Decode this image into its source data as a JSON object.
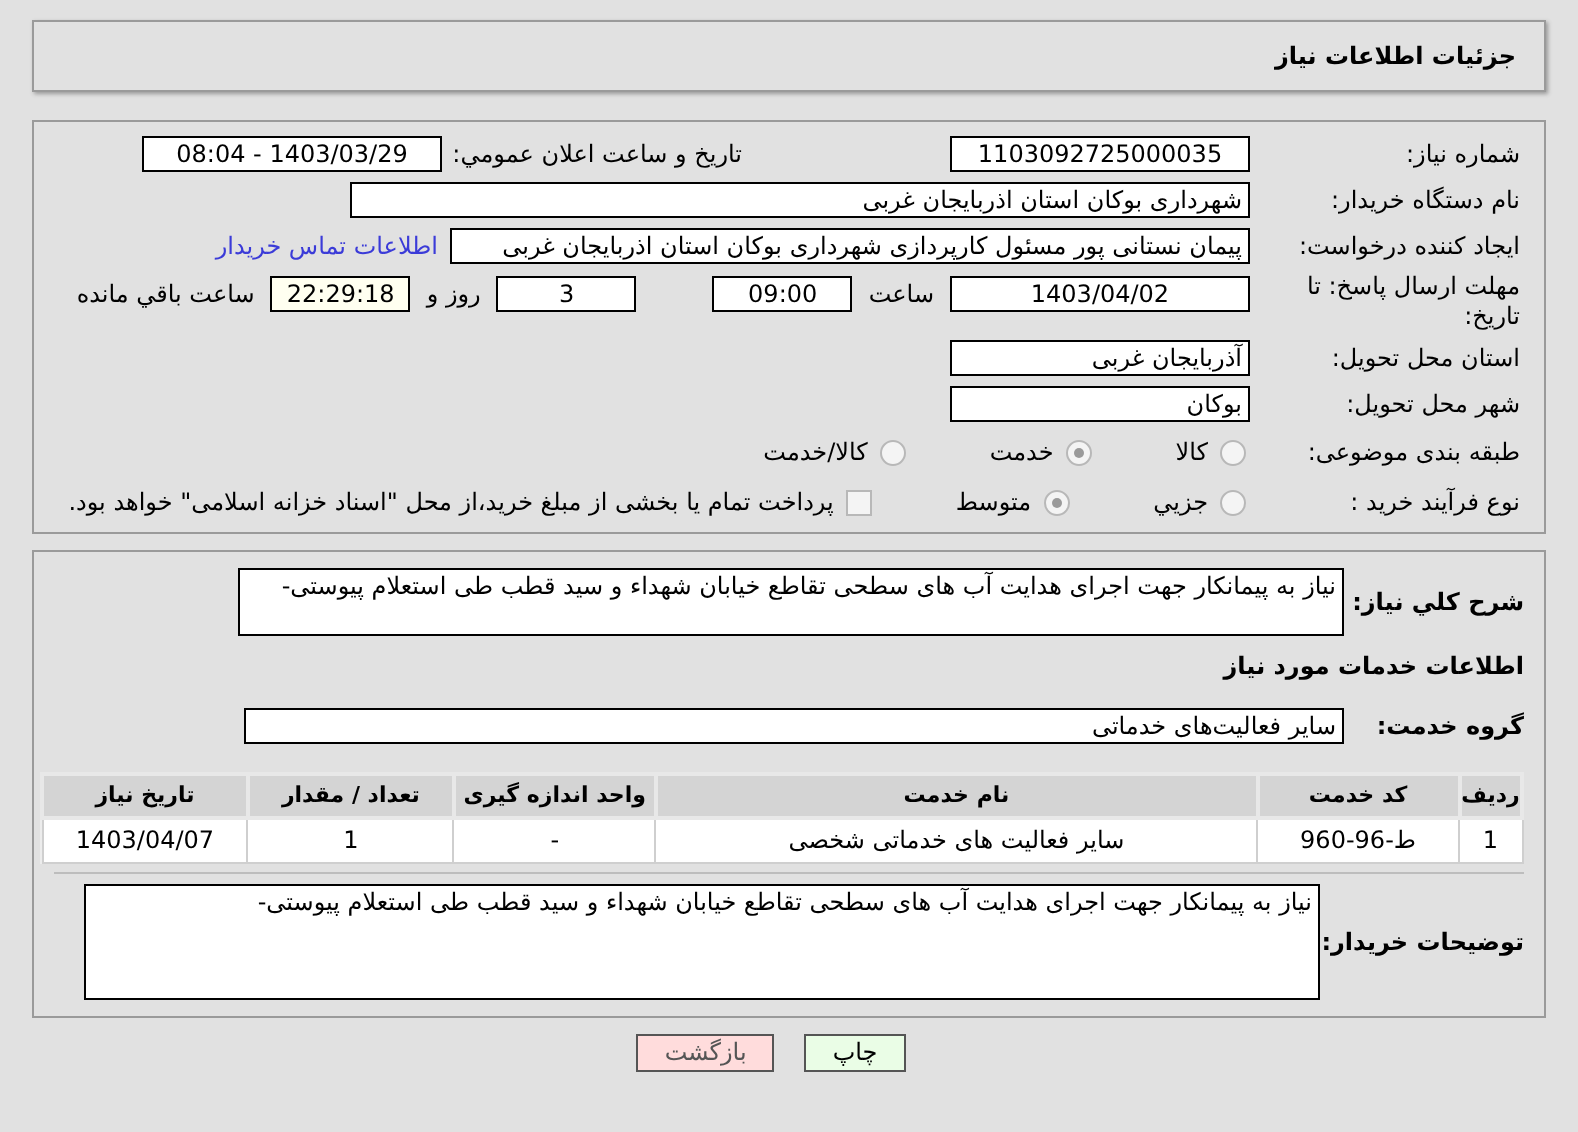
{
  "header": {
    "title": "جزئیات اطلاعات نیاز"
  },
  "need_number": {
    "label": "شماره نیاز:",
    "value": "1103092725000035"
  },
  "announce": {
    "label": "تاریخ و ساعت اعلان عمومي:",
    "value": "1403/03/29 - 08:04"
  },
  "buyer_org": {
    "label": "نام دستگاه خریدار:",
    "value": "شهرداری بوکان استان اذربایجان غربی"
  },
  "creator": {
    "label": "ایجاد کننده درخواست:",
    "value": "پیمان نستانی پور مسئول کارپردازی شهرداری بوکان استان اذربایجان غربی",
    "link": "اطلاعات تماس خریدار"
  },
  "deadline": {
    "label": "مهلت ارسال پاسخ: تا تاریخ:",
    "date": "1403/04/02",
    "time_label": "ساعت",
    "time": "09:00",
    "days": "3",
    "days_label": "روز و",
    "remaining": "22:29:18",
    "remaining_label": "ساعت باقي مانده"
  },
  "province": {
    "label": "استان محل تحویل:",
    "value": "آذربایجان غربی"
  },
  "city": {
    "label": "شهر محل تحویل:",
    "value": "بوکان"
  },
  "category": {
    "label": "طبقه بندی موضوعی:",
    "options": [
      {
        "label": "کالا",
        "selected": false
      },
      {
        "label": "خدمت",
        "selected": true
      },
      {
        "label": "کالا/خدمت",
        "selected": false
      }
    ]
  },
  "purchase_type": {
    "label": "نوع فرآیند خرید :",
    "options": [
      {
        "label": "جزیي",
        "selected": false
      },
      {
        "label": "متوسط",
        "selected": true
      }
    ],
    "treasury": {
      "checked": false,
      "text": "پرداخت تمام یا بخشی از مبلغ خرید،از محل \"اسناد خزانه اسلامی\" خواهد بود."
    }
  },
  "summary": {
    "label": "شرح کلي نیاز:",
    "value": "نیاز به پیمانکار جهت اجرای هدایت آب های سطحی تقاطع خیابان شهداء و سید قطب طی استعلام پیوستی-"
  },
  "services_heading": "اطلاعات خدمات مورد نیاز",
  "service_group": {
    "label": "گروه خدمت:",
    "value": "سایر فعالیت‌های خدماتی"
  },
  "table": {
    "columns": [
      "ردیف",
      "کد خدمت",
      "نام خدمت",
      "واحد اندازه گیری",
      "تعداد / مقدار",
      "تاریخ نیاز"
    ],
    "rows": [
      [
        "1",
        "ط-96-960",
        "سایر فعالیت های خدماتی شخصی",
        "-",
        "1",
        "1403/04/07"
      ]
    ]
  },
  "buyer_notes": {
    "label": "توضیحات خریدار:",
    "value": "نیاز به پیمانکار جهت اجرای هدایت آب های سطحی تقاطع خیابان شهداء و سید قطب طی استعلام پیوستی-"
  },
  "buttons": [
    {
      "label": "چاپ",
      "kind": "print"
    },
    {
      "label": "بازگشت",
      "kind": "back"
    }
  ]
}
